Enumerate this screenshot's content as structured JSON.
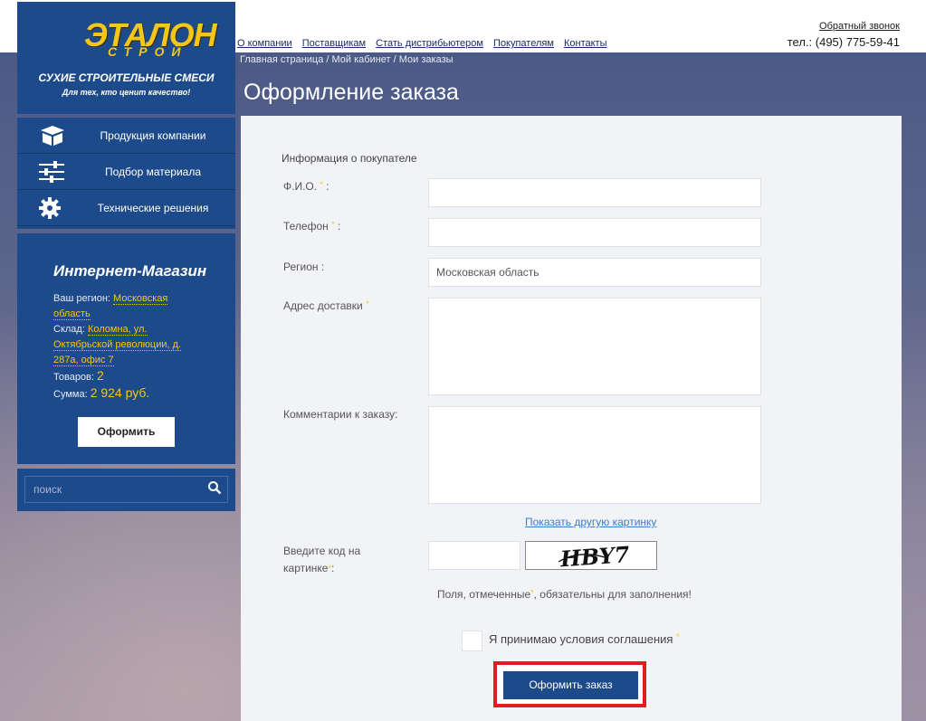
{
  "logo": {
    "brand": "ЭТАЛОН",
    "brand_sub": "СТРОЙ",
    "tagline": "СУХИЕ СТРОИТЕЛЬНЫЕ СМЕСИ",
    "slogan": "Для тех, кто ценит качество!"
  },
  "topnav": [
    "О компании",
    "Поставщикам",
    "Стать дистрибьютером",
    "Покупателям",
    "Контакты"
  ],
  "header": {
    "callback": "Обратный звонок",
    "phone": "тел.: (495) 775-59-41"
  },
  "breadcrumb": "Главная страница  /  Мой кабинет  /  Мои заказы",
  "page_title": "Оформление заказа",
  "sidemenu": [
    {
      "label": "Продукция компании",
      "icon": "box-icon"
    },
    {
      "label": "Подбор материала",
      "icon": "sliders-icon"
    },
    {
      "label": "Технические решения",
      "icon": "gear-icon"
    }
  ],
  "shop": {
    "title": "Интернет-Магазин",
    "region_label": "Ваш регион:",
    "region_value": "Московская область",
    "store_label": "Склад:",
    "store_value": "Коломна, ул. Октябрьской революции, д. 287а, офис 7",
    "items_label": "Товаров:",
    "items_value": "2",
    "sum_label": "Сумма:",
    "sum_value": "2 924 руб.",
    "checkout_label": "Оформить"
  },
  "search": {
    "placeholder": "поиск"
  },
  "form": {
    "section_title": "Информация о покупателе",
    "fio_label": "Ф.И.О.",
    "phone_label": "Телефон",
    "region_label": "Регион :",
    "region_value": "Московская область",
    "address_label": "Адрес доставки",
    "comment_label": "Комментарии к заказу:",
    "show_other_label": "Показать другую картинку",
    "captcha_label_1": "Введите код на",
    "captcha_label_2": "картинке",
    "captcha_text": "HBY7",
    "required_note_a": "Поля, отмеченные",
    "required_note_b": ", обязательны для заполнения!",
    "agree_label": "Я принимаю условия соглашения",
    "submit_label": "Оформить заказ",
    "required_mark": "*"
  },
  "colors": {
    "brand_blue": "#1d4a8a",
    "accent_yellow": "#f3c718",
    "highlight_red": "#e11b22"
  }
}
